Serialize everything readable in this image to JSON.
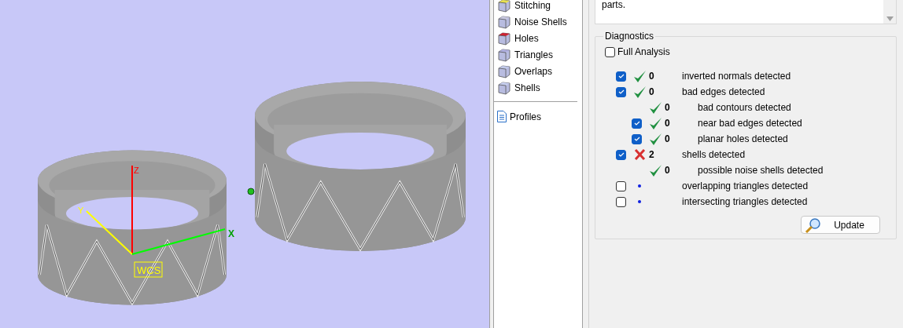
{
  "viewport": {
    "axis_labels": {
      "z": "Z",
      "y": "Y",
      "x": "X",
      "origin": "WCS"
    }
  },
  "sidebar": {
    "items": [
      {
        "label": "Stitching"
      },
      {
        "label": "Noise Shells"
      },
      {
        "label": "Holes"
      },
      {
        "label": "Triangles"
      },
      {
        "label": "Overlaps"
      },
      {
        "label": "Shells"
      }
    ],
    "profiles": {
      "label": "Profiles"
    }
  },
  "description": {
    "text": "parts."
  },
  "diagnostics": {
    "title": "Diagnostics",
    "full_analysis": {
      "label": "Full Analysis",
      "checked": false
    },
    "rows": [
      {
        "kind": "ok",
        "checked": true,
        "count": "0",
        "label": "inverted normals detected"
      },
      {
        "kind": "ok",
        "checked": true,
        "count": "0",
        "label": "bad edges detected",
        "children": [
          {
            "kind": "ok",
            "count": "0",
            "label": "bad contours detected"
          },
          {
            "kind": "ok",
            "checked": true,
            "count": "0",
            "label": "near bad edges detected"
          },
          {
            "kind": "ok",
            "checked": true,
            "count": "0",
            "label": "planar holes detected"
          }
        ]
      },
      {
        "kind": "error",
        "checked": true,
        "count": "2",
        "label": "shells detected",
        "children": [
          {
            "kind": "ok",
            "count": "0",
            "label": "possible noise shells detected"
          }
        ]
      },
      {
        "kind": "pending",
        "checked": false,
        "label": "overlapping triangles detected"
      },
      {
        "kind": "pending",
        "checked": false,
        "label": "intersecting triangles detected"
      }
    ],
    "update_button": {
      "label": "Update"
    }
  }
}
